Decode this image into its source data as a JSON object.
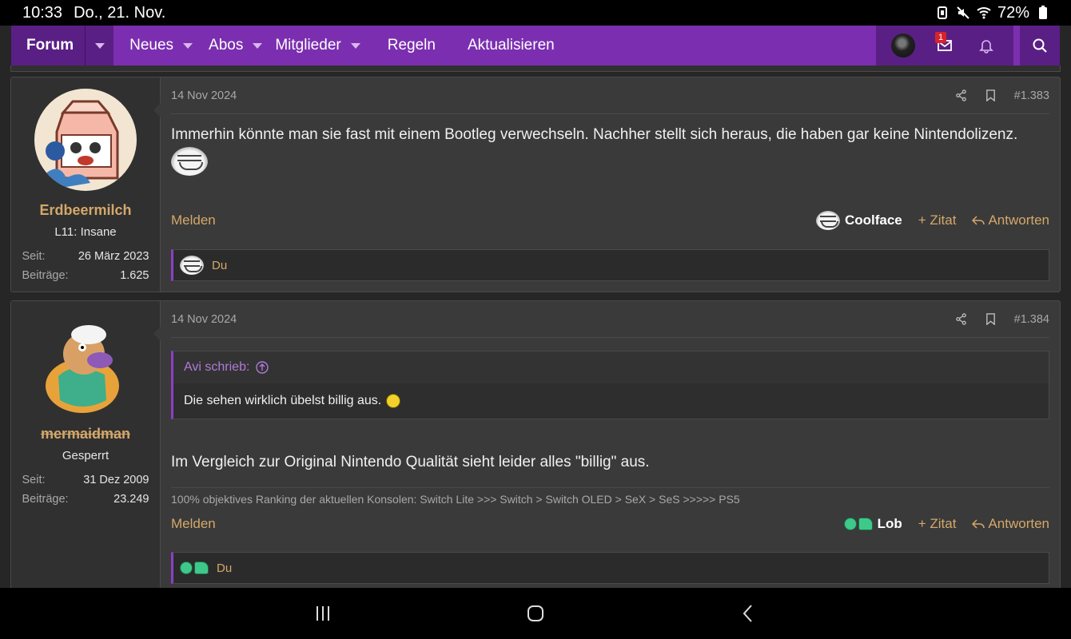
{
  "status": {
    "time": "10:33",
    "date": "Do., 21. Nov.",
    "battery": "72%"
  },
  "nav": {
    "forum": "Forum",
    "items": [
      "Neues",
      "Abos",
      "Mitglieder",
      "Regeln",
      "Aktualisieren"
    ],
    "inbox_badge": "1"
  },
  "posts": [
    {
      "author": "Erdbeermilch",
      "user_title": "L11: Insane",
      "since_label": "Seit:",
      "since": "26 März 2023",
      "posts_label": "Beiträge:",
      "post_count": "1.625",
      "date": "14 Nov 2024",
      "number": "#1.383",
      "text": "Immerhin könnte man sie fast mit einem Bootleg verwechseln. Nachher stellt sich heraus, die haben gar keine Nintendolizenz.",
      "report": "Melden",
      "reaction": "Coolface",
      "quote_action": "+ Zitat",
      "reply_action": "Antworten",
      "reacted_by": "Du"
    },
    {
      "author": "mermaidman",
      "user_title": "Gesperrt",
      "since_label": "Seit:",
      "since": "31 Dez 2009",
      "posts_label": "Beiträge:",
      "post_count": "23.249",
      "date": "14 Nov 2024",
      "number": "#1.384",
      "quote_author": "Avi schrieb:",
      "quote_text": "Die sehen wirklich übelst billig aus.",
      "text": "Im Vergleich zur Original Nintendo Qualität sieht leider alles \"billig\" aus.",
      "signature": "100% objektives Ranking der aktuellen Konsolen: Switch Lite >>> Switch > Switch OLED > SeX > SeS >>>>> PS5",
      "report": "Melden",
      "reaction": "Lob",
      "quote_action": "+ Zitat",
      "reply_action": "Antworten",
      "reacted_by": "Du"
    }
  ]
}
